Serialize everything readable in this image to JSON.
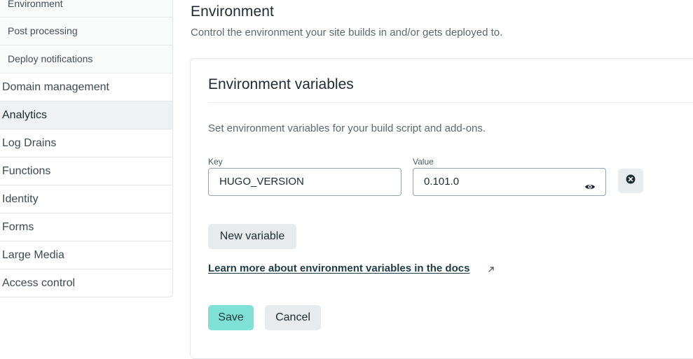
{
  "sidebar": {
    "sub_items": [
      {
        "label": "Environment"
      },
      {
        "label": "Post processing"
      },
      {
        "label": "Deploy notifications"
      }
    ],
    "items": [
      {
        "label": "Domain management"
      },
      {
        "label": "Analytics"
      },
      {
        "label": "Log Drains"
      },
      {
        "label": "Functions"
      },
      {
        "label": "Identity"
      },
      {
        "label": "Forms"
      },
      {
        "label": "Large Media"
      },
      {
        "label": "Access control"
      }
    ]
  },
  "main": {
    "title": "Environment",
    "description": "Control the environment your site builds in and/or gets deployed to.",
    "card": {
      "title": "Environment variables",
      "description": "Set environment variables for your build script and add-ons.",
      "key_label": "Key",
      "key_value": "HUGO_VERSION",
      "value_label": "Value",
      "value_value": "0.101.0",
      "new_variable_label": "New variable",
      "docs_link": "Learn more about environment variables in the docs",
      "save_label": "Save",
      "cancel_label": "Cancel"
    }
  },
  "icons": {
    "reveal": "eye-icon",
    "remove": "close-circle-icon",
    "external": "arrow-up-right-icon"
  },
  "colors": {
    "primary_button": "#7fe0d6",
    "secondary_button": "#e8ebed",
    "active_nav": "#eff1f3"
  }
}
